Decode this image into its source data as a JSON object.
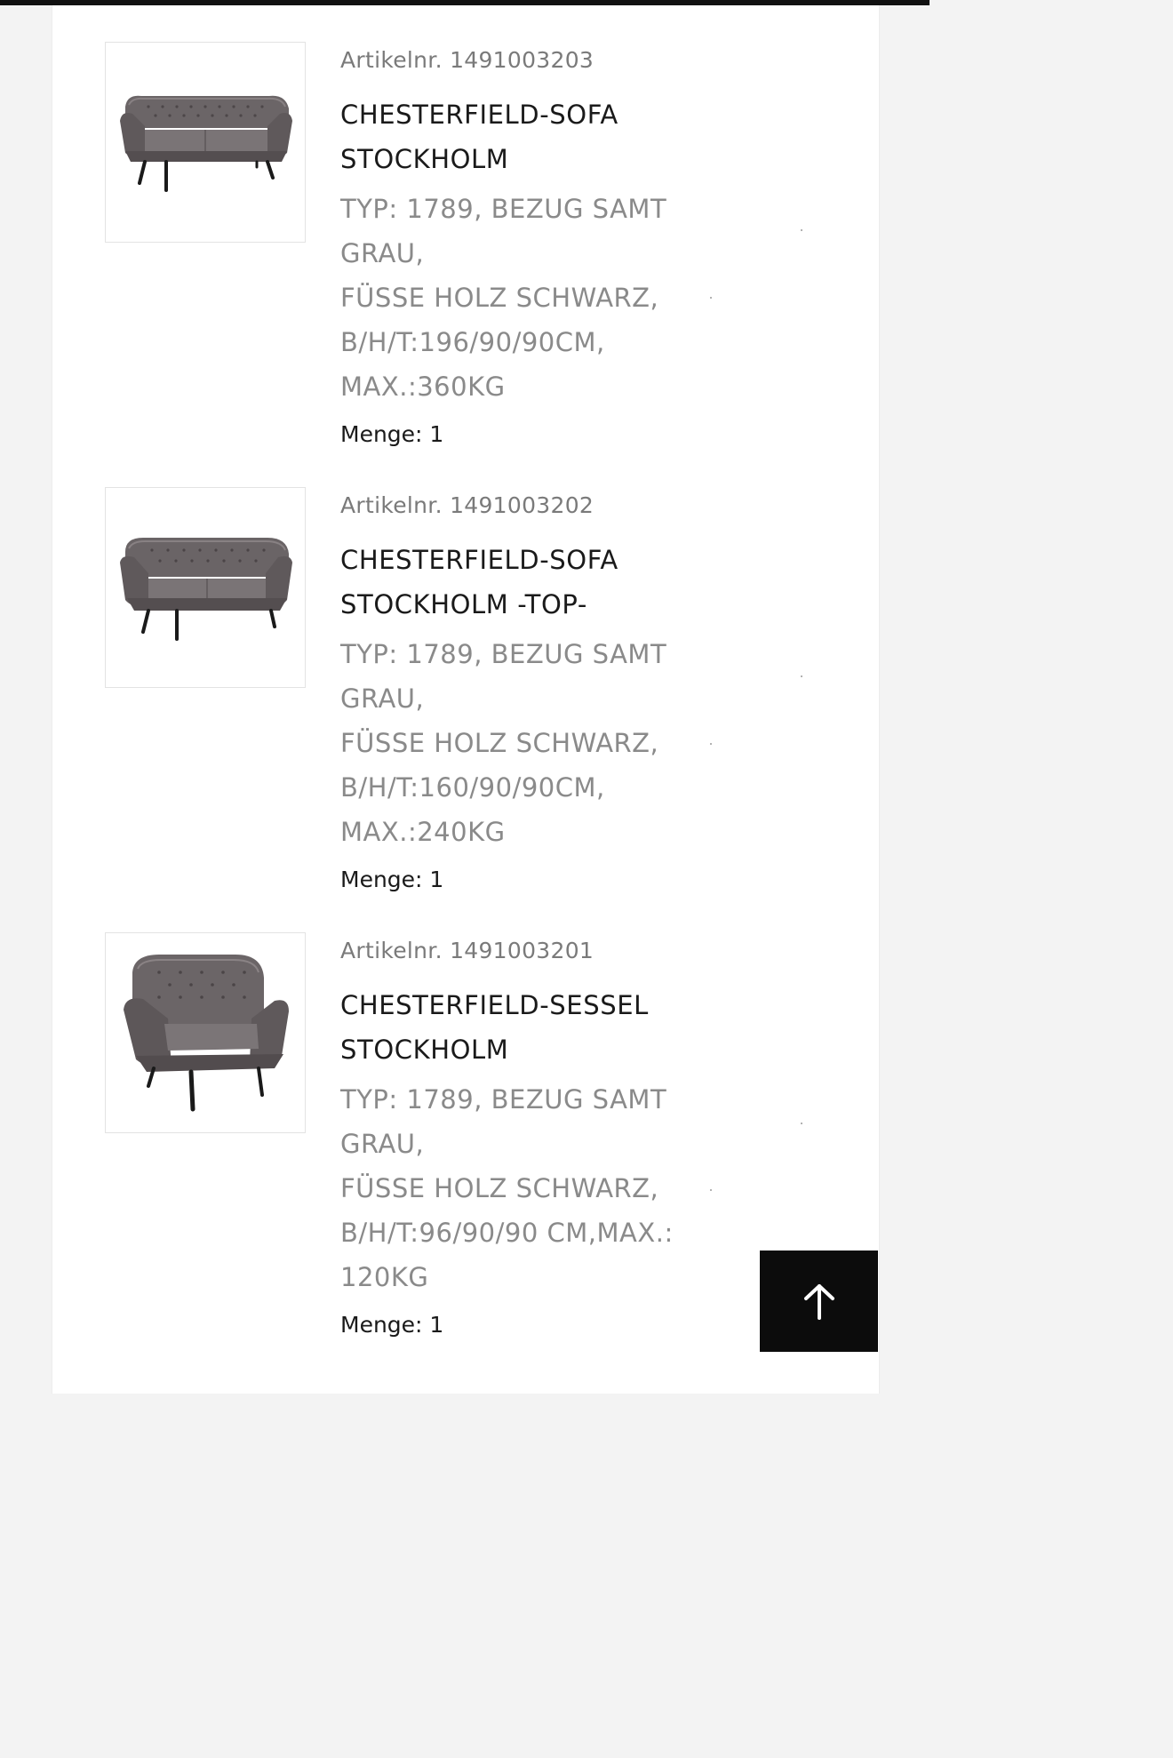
{
  "products": [
    {
      "article_label": "Artikelnr. 1491003203",
      "title_line1": "CHESTERFIELD-SOFA",
      "title_line2": "STOCKHOLM",
      "desc_lines": [
        "TYP: 1789, BEZUG SAMT",
        "GRAU,",
        "FÜSSE HOLZ SCHWARZ,",
        "B/H/T:196/90/90CM,",
        "MAX.:360KG"
      ],
      "quantity": "Menge: 1",
      "image_icon": "three-seat-sofa-image"
    },
    {
      "article_label": "Artikelnr. 1491003202",
      "title_line1": "CHESTERFIELD-SOFA",
      "title_line2": "STOCKHOLM -TOP-",
      "desc_lines": [
        "TYP: 1789, BEZUG SAMT",
        "GRAU,",
        "FÜSSE HOLZ SCHWARZ,",
        "B/H/T:160/90/90CM,",
        "MAX.:240KG"
      ],
      "quantity": "Menge: 1",
      "image_icon": "two-seat-sofa-image"
    },
    {
      "article_label": "Artikelnr. 1491003201",
      "title_line1": "CHESTERFIELD-SESSEL",
      "title_line2": "STOCKHOLM",
      "desc_lines": [
        "TYP: 1789, BEZUG SAMT",
        "GRAU,",
        "FÜSSE HOLZ SCHWARZ,",
        "B/H/T:96/90/90 CM,MAX.:",
        "120KG"
      ],
      "quantity": "Menge: 1",
      "image_icon": "armchair-image"
    }
  ],
  "scroll_top_button": {
    "icon": "arrow-up-icon"
  },
  "colors": {
    "page_background": "#f3f3f3",
    "panel_background": "#ffffff",
    "title_text": "#1a1a1a",
    "muted_text": "#8a8a8a",
    "button_background": "#0c0c0c"
  }
}
